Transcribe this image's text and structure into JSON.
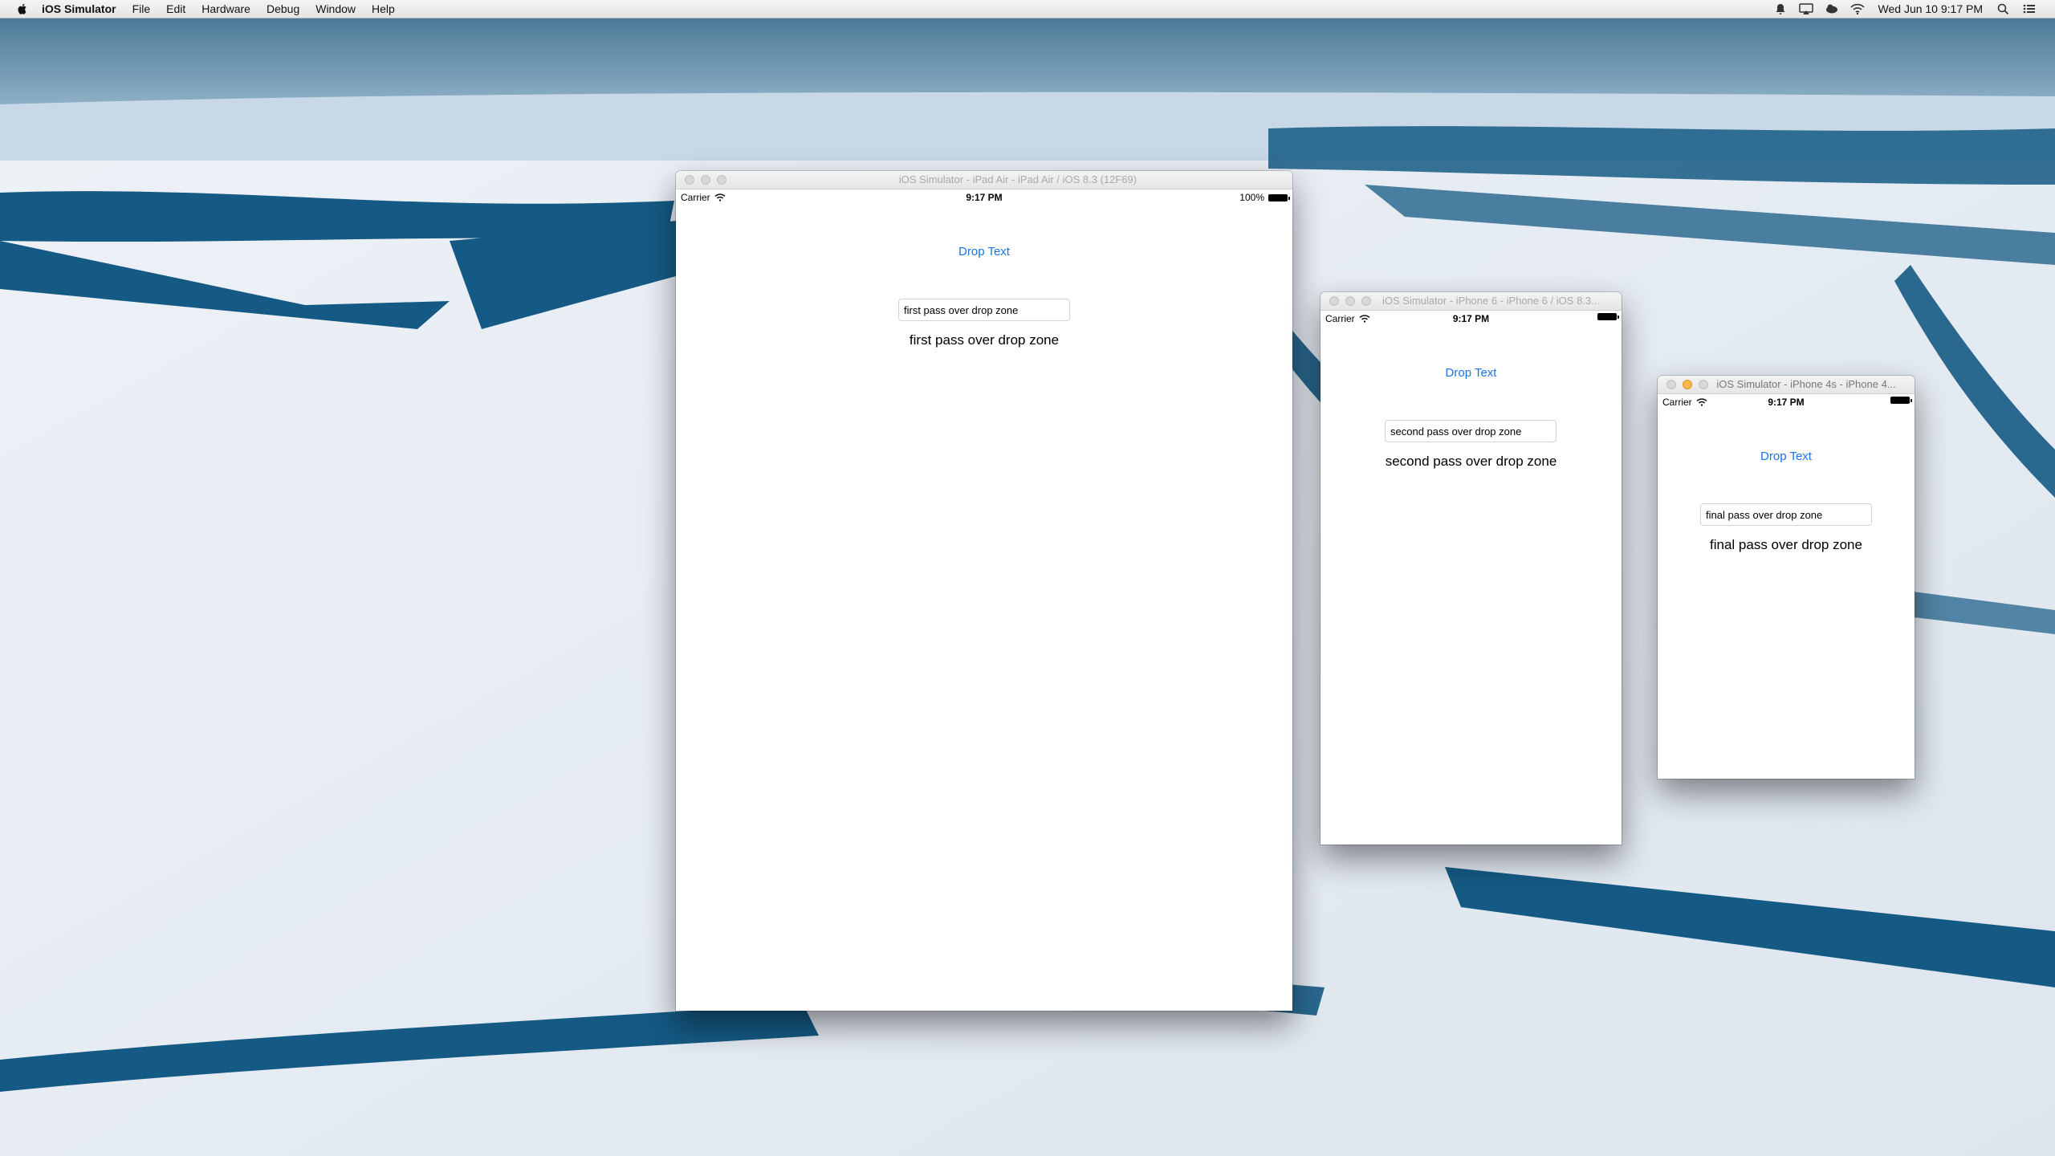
{
  "menubar": {
    "app_name": "iOS Simulator",
    "items": [
      "File",
      "Edit",
      "Hardware",
      "Debug",
      "Window",
      "Help"
    ],
    "clock": "Wed Jun 10  9:17 PM"
  },
  "windows": [
    {
      "title": "iOS Simulator - iPad Air - iPad Air / iOS 8.3 (12F69)",
      "status": {
        "carrier": "Carrier",
        "time": "9:17 PM",
        "battery": "100%"
      },
      "button_label": "Drop Text",
      "field_value": "first pass over drop zone",
      "label_text": "first pass over drop zone"
    },
    {
      "title": "iOS Simulator - iPhone 6 - iPhone 6 / iOS 8.3...",
      "status": {
        "carrier": "Carrier",
        "time": "9:17 PM",
        "battery": ""
      },
      "button_label": "Drop Text",
      "field_value": "second pass over drop zone",
      "label_text": "second pass over drop zone"
    },
    {
      "title": "iOS Simulator - iPhone 4s - iPhone 4...",
      "status": {
        "carrier": "Carrier",
        "time": "9:17 PM",
        "battery": ""
      },
      "button_label": "Drop Text",
      "field_value": "final pass over drop zone",
      "label_text": "final pass over drop zone"
    }
  ],
  "colors": {
    "accent": "#1a73e8",
    "sea": "#155a84",
    "ice": "#e6ecf2"
  }
}
